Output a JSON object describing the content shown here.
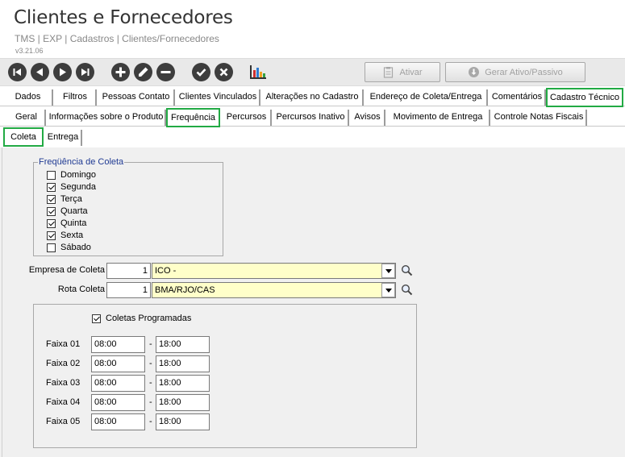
{
  "header": {
    "title": "Clientes e Fornecedores",
    "breadcrumb": "TMS | EXP | Cadastros | Clientes/Fornecedores",
    "version": "v3.21.06"
  },
  "toolbar": {
    "ativar_label": "Ativar",
    "gerar_label": "Gerar Ativo/Passivo"
  },
  "tabs_main": [
    "Dados",
    "Filtros",
    "Pessoas Contato",
    "Clientes Vinculados",
    "Alterações no Cadastro",
    "Endereço de Coleta/Entrega",
    "Comentários",
    "Cadastro Técnico"
  ],
  "tabs_sub": [
    "Geral",
    "Informações sobre o Produto",
    "Frequência",
    "Percursos",
    "Percursos Inativo",
    "Avisos",
    "Movimento de Entrega",
    "Controle Notas Fiscais"
  ],
  "tabs_inner": [
    "Coleta",
    "Entrega"
  ],
  "frequencia": {
    "legend": "Freqüência de Coleta",
    "days": [
      {
        "label": "Domingo",
        "checked": false
      },
      {
        "label": "Segunda",
        "checked": true
      },
      {
        "label": "Terça",
        "checked": true
      },
      {
        "label": "Quarta",
        "checked": true
      },
      {
        "label": "Quinta",
        "checked": true
      },
      {
        "label": "Sexta",
        "checked": true
      },
      {
        "label": "Sábado",
        "checked": false
      }
    ]
  },
  "empresa": {
    "label": "Empresa de Coleta",
    "code": "1",
    "value": "ICO -"
  },
  "rota": {
    "label": "Rota Coleta",
    "code": "1",
    "value": "BMA/RJO/CAS"
  },
  "programadas": {
    "label": "Coletas Programadas",
    "checked": true
  },
  "faixas": [
    {
      "label": "Faixa 01",
      "start": "08:00",
      "end": "18:00"
    },
    {
      "label": "Faixa 02",
      "start": "08:00",
      "end": "18:00"
    },
    {
      "label": "Faixa 03",
      "start": "08:00",
      "end": "18:00"
    },
    {
      "label": "Faixa 04",
      "start": "08:00",
      "end": "18:00"
    },
    {
      "label": "Faixa 05",
      "start": "08:00",
      "end": "18:00"
    }
  ],
  "dash": "-",
  "colors": {
    "selected_tab": "#22aa44",
    "combo_bg": "#ffffc9",
    "legend_text": "#1f3a93"
  }
}
